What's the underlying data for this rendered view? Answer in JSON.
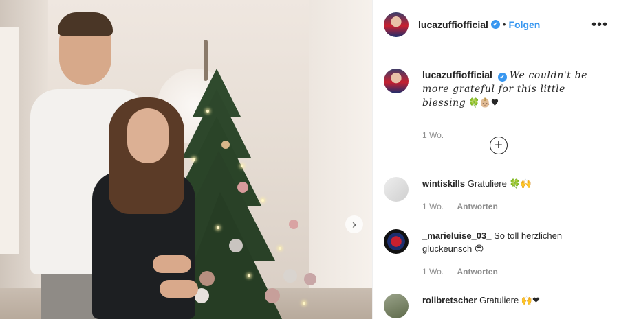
{
  "post": {
    "username": "lucazuffiofficial",
    "verified_mark": "✔",
    "separator": "•",
    "follow_label": "Folgen",
    "more_icon": "•••",
    "caption": {
      "username": "lucazuffiofficial",
      "text": "We couldn't be more grateful for this little blessing",
      "emojis": "🍀👶🏼♥",
      "time": "1 Wo."
    },
    "load_more_icon": "+",
    "next_icon": "›",
    "comments": [
      {
        "username": "wintiskills",
        "text": "Gratuliere",
        "emojis": "🍀🙌",
        "time": "1 Wo.",
        "reply_label": "Antworten"
      },
      {
        "username": "_marieluise_03_",
        "text": "So toll herzlichen glückeunsch",
        "emojis": "😍",
        "time": "1 Wo.",
        "reply_label": "Antworten"
      },
      {
        "username": "rolibretscher",
        "text": "Gratuliere",
        "emojis": "🙌❤",
        "time": "",
        "reply_label": ""
      }
    ]
  }
}
